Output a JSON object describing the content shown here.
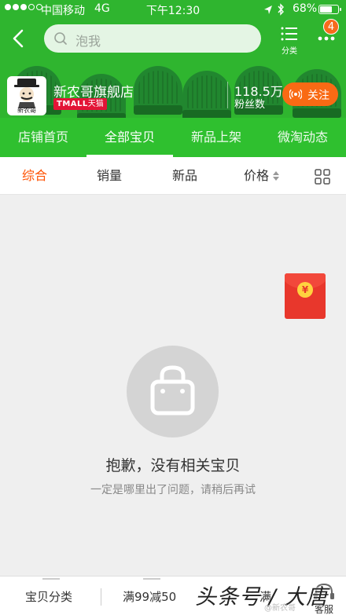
{
  "status_bar": {
    "carrier": "中国移动",
    "network": "4G",
    "time": "下午12:30",
    "battery": "68%"
  },
  "nav": {
    "search_placeholder": "泡我",
    "category_label": "分类",
    "badge_count": "4"
  },
  "shop": {
    "logo_text": "新农哥",
    "name": "新农哥旗舰店",
    "platform_latin": "TMALL",
    "platform_cn": "天猫",
    "fans_count": "118.5万",
    "fans_label": "粉丝数",
    "follow_label": "关注"
  },
  "tabs": [
    {
      "label": "店铺首页"
    },
    {
      "label": "全部宝贝"
    },
    {
      "label": "新品上架"
    },
    {
      "label": "微淘动态"
    }
  ],
  "sort": {
    "items": [
      {
        "label": "综合"
      },
      {
        "label": "销量"
      },
      {
        "label": "新品"
      },
      {
        "label": "价格"
      }
    ]
  },
  "red_packet": {
    "coin_symbol": "¥"
  },
  "empty_state": {
    "title": "抱歉，没有相关宝贝",
    "subtitle": "一定是哪里出了问题，请稍后再试"
  },
  "bottom_bar": {
    "categories": "宝贝分类",
    "promo": "满99减50",
    "promo2": "满",
    "service": "客服"
  },
  "watermark": {
    "main": "头条号 / 大唐",
    "small": "@新农哥"
  },
  "colors": {
    "brand_green": "#2fb52f",
    "accent_orange": "#ff5000",
    "follow_orange": "#f96a14",
    "tmall_red": "#e31436"
  }
}
